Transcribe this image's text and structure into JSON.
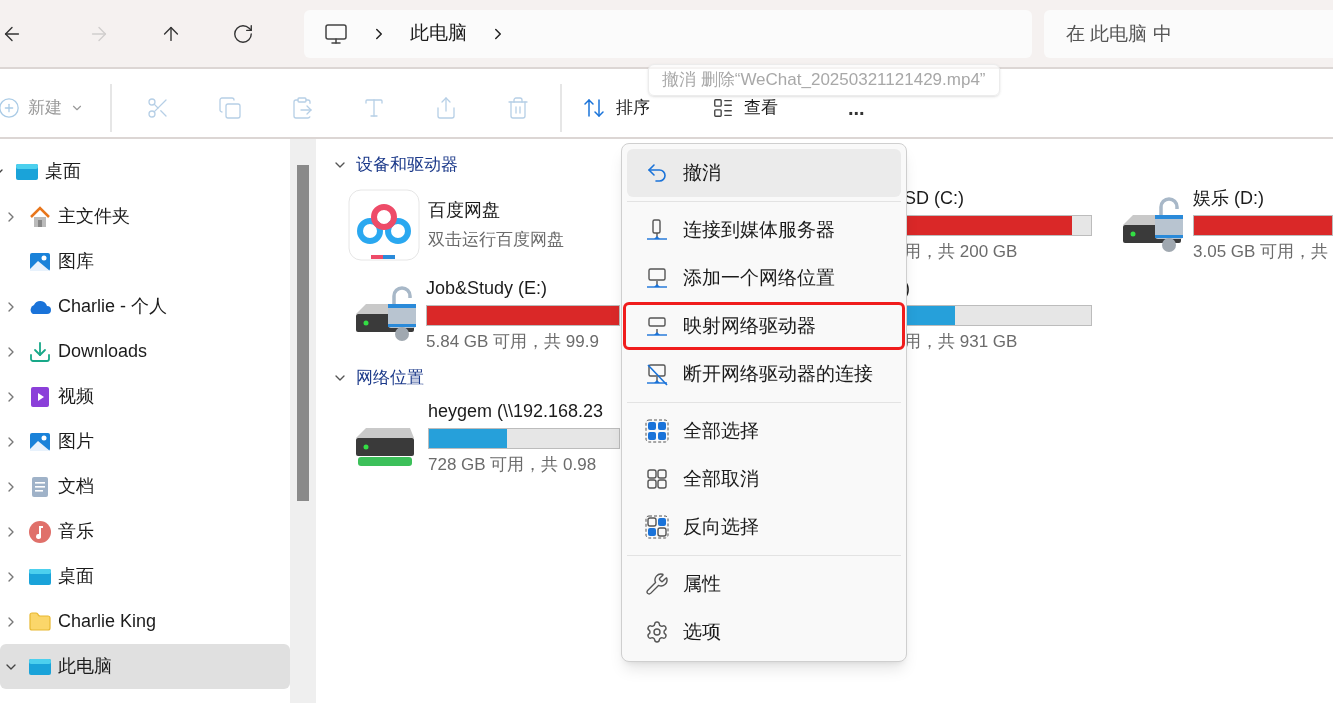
{
  "nav_buttons": [
    {
      "disabled": false
    },
    {
      "disabled": true
    },
    {
      "disabled": false
    },
    {
      "disabled": false
    }
  ],
  "address_bar": {
    "crumbs": [
      "此电脑"
    ]
  },
  "search": {
    "placeholder": "在 此电脑 中"
  },
  "toolbar": {
    "new": {
      "label": "新建",
      "disabled": true
    },
    "actions": [
      {
        "disabled": true
      },
      {
        "disabled": true
      },
      {
        "disabled": true
      },
      {
        "disabled": true
      },
      {
        "disabled": true
      },
      {
        "disabled": true
      }
    ],
    "sort": {
      "label": "排序"
    },
    "view": {
      "label": "查看"
    },
    "more": {
      "label": "..."
    }
  },
  "tooltip": {
    "text": "撤消 删除“WeChat_20250321121429.mp4”"
  },
  "sidebar": {
    "items": [
      {
        "label": "桌面",
        "expandable": true,
        "expanded": true,
        "selected": false,
        "children": [
          {
            "label": "主文件夹",
            "expandable": true,
            "expanded": false,
            "selected": false
          },
          {
            "label": "图库",
            "expandable": false,
            "selected": false
          },
          {
            "label": "Charlie - 个人",
            "expandable": true,
            "expanded": false,
            "selected": false
          },
          {
            "label": "Downloads",
            "expandable": true,
            "expanded": false,
            "selected": false
          },
          {
            "label": "视频",
            "expandable": true,
            "expanded": false,
            "selected": false
          },
          {
            "label": "图片",
            "expandable": true,
            "expanded": false,
            "selected": false
          },
          {
            "label": "文档",
            "expandable": true,
            "expanded": false,
            "selected": false
          },
          {
            "label": "音乐",
            "expandable": true,
            "expanded": false,
            "selected": false
          },
          {
            "label": "桌面",
            "expandable": true,
            "expanded": false,
            "selected": false
          },
          {
            "label": "Charlie King",
            "expandable": true,
            "expanded": false,
            "selected": false
          },
          {
            "label": "此电脑",
            "expandable": true,
            "expanded": true,
            "selected": true
          }
        ]
      }
    ]
  },
  "sections": [
    {
      "title": "设备和驱动器",
      "expanded": true,
      "rows": [
        [
          {
            "kind": "app",
            "name": "百度网盘",
            "subtitle": "双击运行百度网盘"
          },
          {
            "kind": "partly_hidden",
            "name": "SD (C:)",
            "level": 0.9,
            "info": "用，共 200 GB"
          },
          {
            "kind": "locked_drive",
            "name": "娱乐 (D:)",
            "level": 1,
            "info": "3.05 GB 可用，共"
          }
        ],
        [
          {
            "kind": "locked_drive",
            "name": "Job&Study (E:)",
            "level": 1,
            "info": "5.84 GB 可用，共 99.9"
          },
          {
            "kind": "partly_hidden",
            "name": ")",
            "level": 0.27,
            "info": "用，共 931 GB"
          }
        ]
      ]
    },
    {
      "title": "网络位置",
      "expanded": true,
      "rows": [
        [
          {
            "kind": "network_drive",
            "name": "heygem (\\\\192.168.23",
            "level": 0.41,
            "info": "728 GB 可用，共 0.98"
          }
        ]
      ]
    }
  ],
  "context_menu": {
    "groups": [
      [
        {
          "label": "撤消",
          "highlighted": true,
          "marked": false
        }
      ],
      [
        {
          "label": "连接到媒体服务器",
          "highlighted": false,
          "marked": false
        },
        {
          "label": "添加一个网络位置",
          "highlighted": false,
          "marked": false
        },
        {
          "label": "映射网络驱动器",
          "highlighted": false,
          "marked": true
        },
        {
          "label": "断开网络驱动器的连接",
          "highlighted": false,
          "marked": false
        }
      ],
      [
        {
          "label": "全部选择",
          "highlighted": false,
          "marked": false
        },
        {
          "label": "全部取消",
          "highlighted": false,
          "marked": false
        },
        {
          "label": "反向选择",
          "highlighted": false,
          "marked": false
        }
      ],
      [
        {
          "label": "属性",
          "highlighted": false,
          "marked": false
        },
        {
          "label": "选项",
          "highlighted": false,
          "marked": false
        }
      ]
    ]
  }
}
